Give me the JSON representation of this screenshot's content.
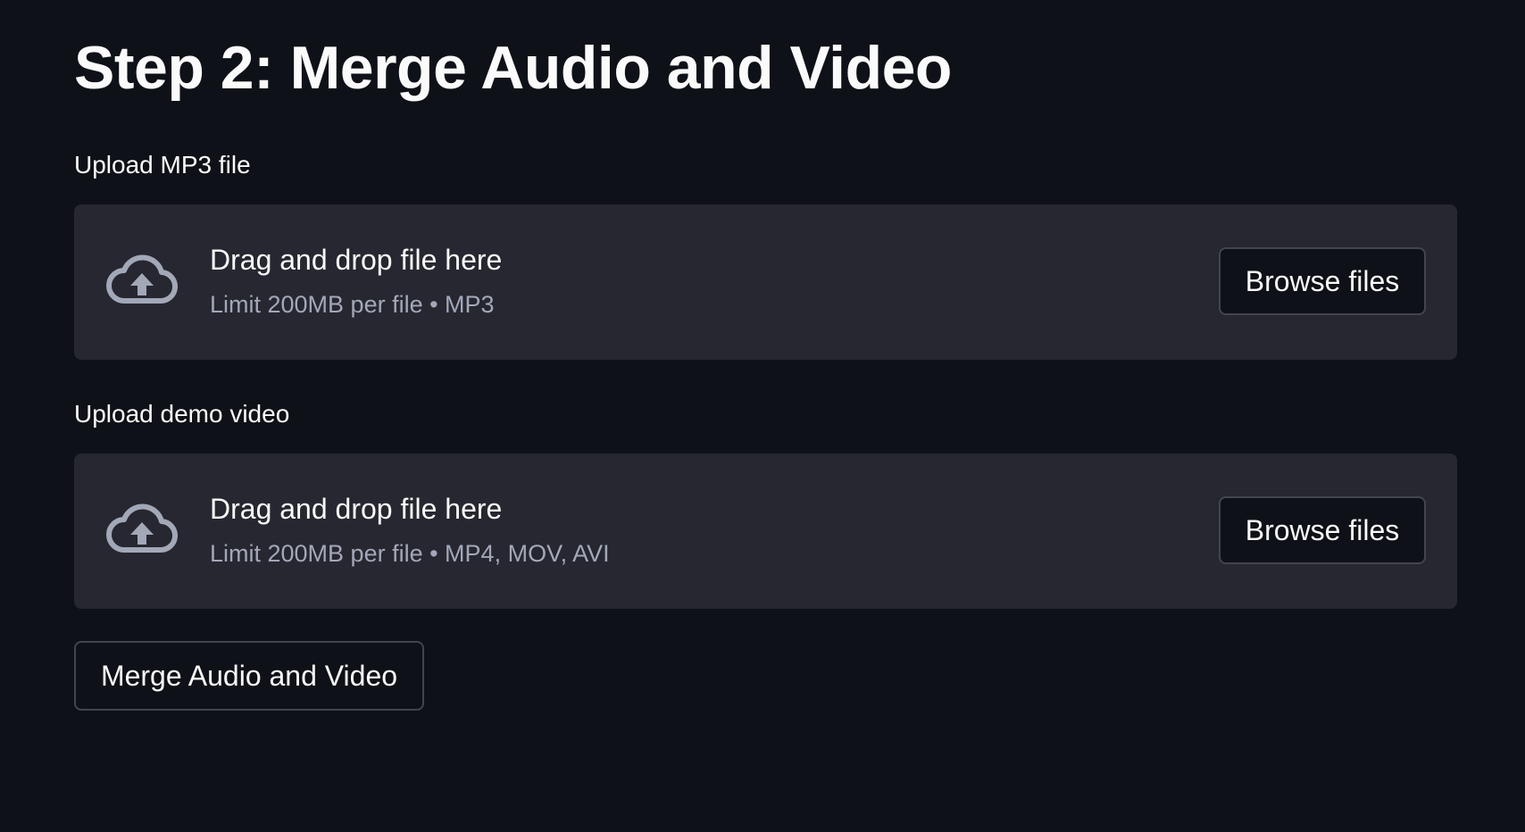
{
  "page": {
    "title": "Step 2: Merge Audio and Video"
  },
  "uploaders": [
    {
      "label": "Upload MP3 file",
      "dropzone_title": "Drag and drop file here",
      "limit_text": "Limit 200MB per file • MP3",
      "browse_label": "Browse files",
      "icon": "cloud-upload-icon"
    },
    {
      "label": "Upload demo video",
      "dropzone_title": "Drag and drop file here",
      "limit_text": "Limit 200MB per file • MP4, MOV, AVI",
      "browse_label": "Browse files",
      "icon": "cloud-upload-icon"
    }
  ],
  "actions": {
    "merge_label": "Merge Audio and Video"
  },
  "colors": {
    "background": "#0e1117",
    "dropzone": "#262730",
    "text": "#fafafa",
    "muted_text": "#a3a8b8",
    "icon": "#a3a8b8",
    "button_border": "#42454f"
  }
}
